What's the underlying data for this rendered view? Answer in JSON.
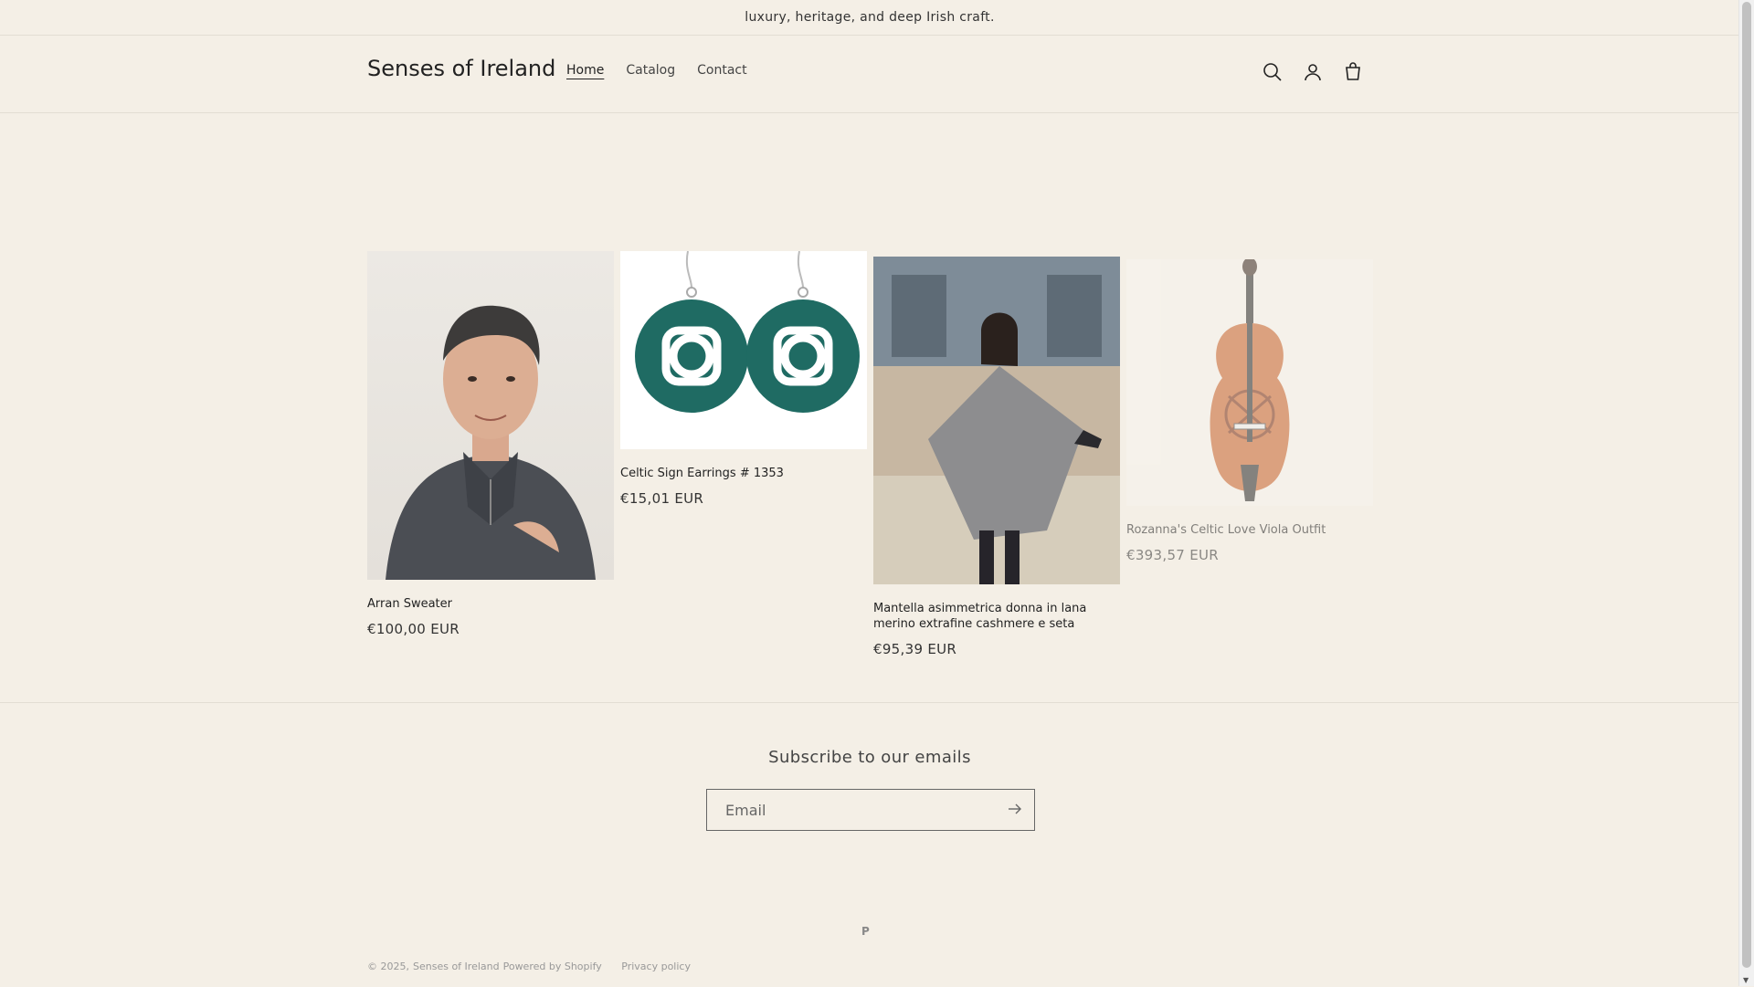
{
  "announcement": "luxury, heritage, and deep Irish craft.",
  "header": {
    "brand": "Senses of Ireland",
    "nav": [
      "Home",
      "Catalog",
      "Contact"
    ],
    "active": "Home"
  },
  "products": [
    {
      "title": "Arran Sweater",
      "price": "€100,00 EUR"
    },
    {
      "title": "Celtic Sign Earrings # 1353",
      "price": "€15,01 EUR"
    },
    {
      "title": "Mantella asimmetrica donna in lana merino extrafine cashmere e seta",
      "price": "€95,39 EUR"
    },
    {
      "title": "Rozanna's Celtic Love Viola Outfit",
      "price": "€393,57 EUR"
    }
  ],
  "footer": {
    "subscribe_title": "Subscribe to our emails",
    "email_placeholder": "Email",
    "payment": "P",
    "copyright_year": "© 2025,",
    "copyright_store": "Senses of Ireland",
    "powered": "Powered by Shopify",
    "privacy": "Privacy policy"
  },
  "colors": {
    "background": "#f4efe6",
    "text": "#222222",
    "earring_green": "#1f6b63",
    "viola_orange": "#c8632b"
  }
}
